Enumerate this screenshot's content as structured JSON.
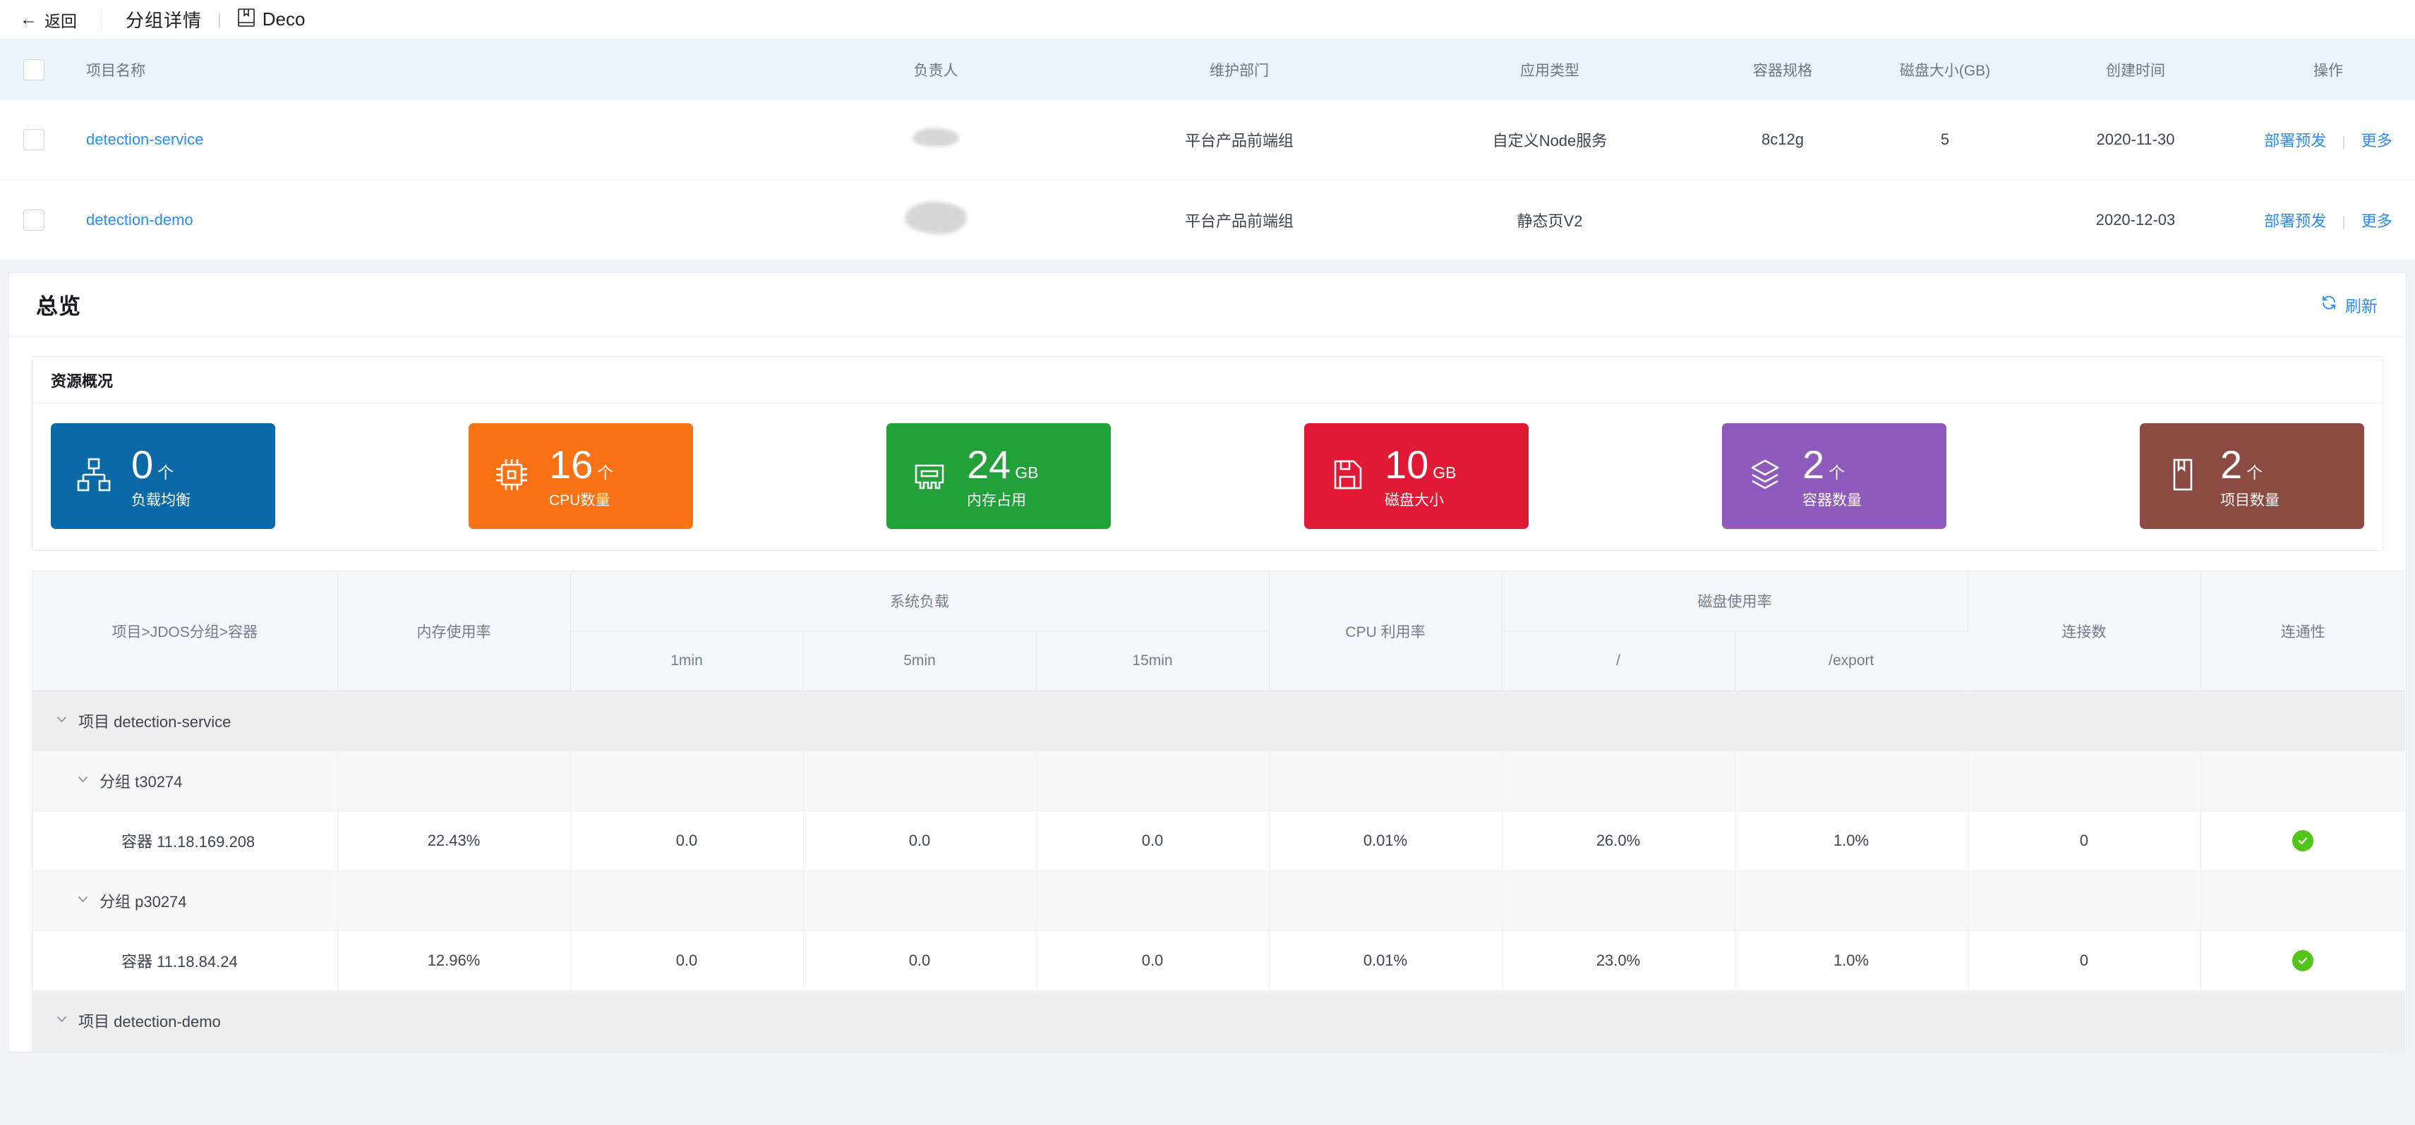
{
  "topbar": {
    "back_label": "返回",
    "breadcrumb_title": "分组详情",
    "separator": "|",
    "deco_name": "Deco"
  },
  "project_table": {
    "columns": {
      "name": "项目名称",
      "owner": "负责人",
      "dept": "维护部门",
      "app_type": "应用类型",
      "spec": "容器规格",
      "disk": "磁盘大小(GB)",
      "created": "创建时间",
      "action": "操作"
    },
    "rows": [
      {
        "name": "detection-service",
        "owner": "",
        "dept": "平台产品前端组",
        "app_type": "自定义Node服务",
        "spec": "8c12g",
        "disk": "5",
        "created": "2020-11-30",
        "action_deploy": "部署预发",
        "action_more": "更多"
      },
      {
        "name": "detection-demo",
        "owner": "",
        "dept": "平台产品前端组",
        "app_type": "静态页V2",
        "spec": "",
        "disk": "",
        "created": "2020-12-03",
        "action_deploy": "部署预发",
        "action_more": "更多"
      }
    ]
  },
  "overview": {
    "title": "总览",
    "refresh_label": "刷新",
    "resource_box_title": "资源概况",
    "cards": [
      {
        "value": "0",
        "unit": "个",
        "label": "负载均衡",
        "color": "#0a6aa8",
        "icon": "sitemap-icon"
      },
      {
        "value": "16",
        "unit": "个",
        "label": "CPU数量",
        "color": "#f97316",
        "icon": "cpu-icon"
      },
      {
        "value": "24",
        "unit": "GB",
        "label": "内存占用",
        "color": "#22a03a",
        "icon": "memory-icon"
      },
      {
        "value": "10",
        "unit": "GB",
        "label": "磁盘大小",
        "color": "#e01934",
        "icon": "disk-icon"
      },
      {
        "value": "2",
        "unit": "个",
        "label": "容器数量",
        "color": "#8e5bbd",
        "icon": "layers-icon"
      },
      {
        "value": "2",
        "unit": "个",
        "label": "项目数量",
        "color": "#8b4a42",
        "icon": "book-icon"
      }
    ]
  },
  "metrics_table": {
    "columns": {
      "tree": "项目>JDOS分组>容器",
      "memory": "内存使用率",
      "sysload": "系统负载",
      "load_1min": "1min",
      "load_5min": "5min",
      "load_15min": "15min",
      "cpu": "CPU 利用率",
      "disk_usage": "磁盘使用率",
      "disk_root": "/",
      "disk_export": "/export",
      "connections": "连接数",
      "connectivity": "连通性"
    },
    "rows": [
      {
        "level": 0,
        "label": "项目 detection-service",
        "expanded": true,
        "memory": "",
        "l1": "",
        "l5": "",
        "l15": "",
        "cpu": "",
        "disk_root": "",
        "disk_export": "",
        "connections": "",
        "status": ""
      },
      {
        "level": 1,
        "label": "分组 t30274",
        "expanded": true,
        "memory": "",
        "l1": "",
        "l5": "",
        "l15": "",
        "cpu": "",
        "disk_root": "",
        "disk_export": "",
        "connections": "",
        "status": ""
      },
      {
        "level": 2,
        "label": "容器 11.18.169.208",
        "expanded": false,
        "memory": "22.43%",
        "l1": "0.0",
        "l5": "0.0",
        "l15": "0.0",
        "cpu": "0.01%",
        "disk_root": "26.0%",
        "disk_export": "1.0%",
        "connections": "0",
        "status": "ok"
      },
      {
        "level": 1,
        "label": "分组 p30274",
        "expanded": true,
        "memory": "",
        "l1": "",
        "l5": "",
        "l15": "",
        "cpu": "",
        "disk_root": "",
        "disk_export": "",
        "connections": "",
        "status": ""
      },
      {
        "level": 2,
        "label": "容器 11.18.84.24",
        "expanded": false,
        "memory": "12.96%",
        "l1": "0.0",
        "l5": "0.0",
        "l15": "0.0",
        "cpu": "0.01%",
        "disk_root": "23.0%",
        "disk_export": "1.0%",
        "connections": "0",
        "status": "ok"
      },
      {
        "level": 0,
        "label": "项目 detection-demo",
        "expanded": true,
        "memory": "",
        "l1": "",
        "l5": "",
        "l15": "",
        "cpu": "",
        "disk_root": "",
        "disk_export": "",
        "connections": "",
        "status": ""
      }
    ]
  }
}
